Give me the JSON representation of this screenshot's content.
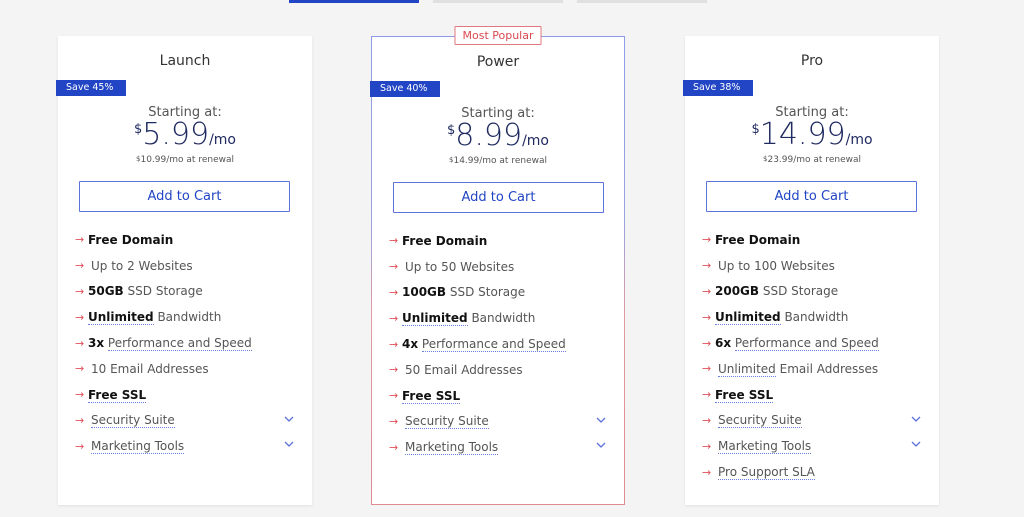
{
  "top_tabs": [
    "",
    "",
    ""
  ],
  "colors": {
    "accent": "#2145c4",
    "arrow": "#e0505a",
    "popular": "#d9484f",
    "price": "#1f2a60"
  },
  "plans": [
    {
      "name": "Launch",
      "badge": "Save 45%",
      "starting_label": "Starting at:",
      "currency": "$",
      "price": "5.99",
      "per": "/mo",
      "renewal_currency": "$",
      "renewal": "10.99/mo at renewal",
      "cta": "Add to Cart",
      "features": [
        {
          "bold": "Free Domain",
          "text": ""
        },
        {
          "bold": "",
          "text": "Up to 2 Websites"
        },
        {
          "bold": "50GB",
          "text": "SSD Storage"
        },
        {
          "bold": "Unlimited",
          "text": "Bandwidth"
        },
        {
          "bold": "3x",
          "text": "Performance and Speed"
        },
        {
          "bold": "",
          "text": "10 Email Addresses"
        },
        {
          "bold": "Free SSL",
          "text": ""
        },
        {
          "bold": "",
          "text": "Security Suite",
          "expandable": true
        },
        {
          "bold": "",
          "text": "Marketing Tools",
          "expandable": true
        }
      ]
    },
    {
      "name": "Power",
      "popular_label": "Most Popular",
      "badge": "Save 40%",
      "starting_label": "Starting at:",
      "currency": "$",
      "price": "8.99",
      "per": "/mo",
      "renewal_currency": "$",
      "renewal": "14.99/mo at renewal",
      "cta": "Add to Cart",
      "features": [
        {
          "bold": "Free Domain",
          "text": ""
        },
        {
          "bold": "",
          "text": "Up to 50 Websites"
        },
        {
          "bold": "100GB",
          "text": "SSD Storage"
        },
        {
          "bold": "Unlimited",
          "text": "Bandwidth"
        },
        {
          "bold": "4x",
          "text": "Performance and Speed"
        },
        {
          "bold": "",
          "text": "50 Email Addresses"
        },
        {
          "bold": "Free SSL",
          "text": ""
        },
        {
          "bold": "",
          "text": "Security Suite",
          "expandable": true
        },
        {
          "bold": "",
          "text": "Marketing Tools",
          "expandable": true
        }
      ]
    },
    {
      "name": "Pro",
      "badge": "Save 38%",
      "starting_label": "Starting at:",
      "currency": "$",
      "price": "14.99",
      "per": "/mo",
      "renewal_currency": "$",
      "renewal": "23.99/mo at renewal",
      "cta": "Add to Cart",
      "features": [
        {
          "bold": "Free Domain",
          "text": ""
        },
        {
          "bold": "",
          "text": "Up to 100 Websites"
        },
        {
          "bold": "200GB",
          "text": "SSD Storage"
        },
        {
          "bold": "Unlimited",
          "text": "Bandwidth"
        },
        {
          "bold": "6x",
          "text": "Performance and Speed"
        },
        {
          "bold": "",
          "text": "Unlimited Email Addresses"
        },
        {
          "bold": "Free SSL",
          "text": ""
        },
        {
          "bold": "",
          "text": "Security Suite",
          "expandable": true
        },
        {
          "bold": "",
          "text": "Marketing Tools",
          "expandable": true
        },
        {
          "bold": "",
          "text": "Pro Support SLA"
        }
      ]
    }
  ]
}
